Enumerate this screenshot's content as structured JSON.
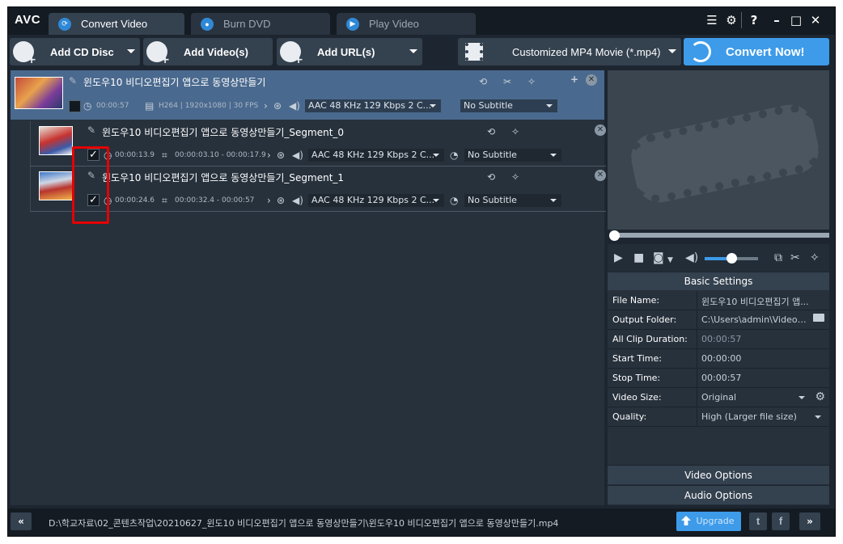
{
  "app": {
    "logo": "AVC"
  },
  "tabs": [
    {
      "label": "Convert Video",
      "icon": "refresh-icon"
    },
    {
      "label": "Burn DVD",
      "icon": "disc-icon"
    },
    {
      "label": "Play Video",
      "icon": "play-icon"
    }
  ],
  "window_controls": [
    "list-icon",
    "gear-icon",
    "help-icon",
    "minimize-icon",
    "maximize-icon",
    "close-icon"
  ],
  "help_label": "?",
  "toolbar": {
    "add_cd": "Add CD Disc",
    "add_video": "Add Video(s)",
    "add_url": "Add URL(s)",
    "profile": "Customized MP4 Movie (*.mp4)",
    "convert_now": "Convert Now!"
  },
  "files": {
    "main": {
      "title": "윈도우10 비디오편집기 앱으로 동영상만들기",
      "duration": "00:00:57",
      "video_info": "H264 | 1920x1080 | 30 FPS",
      "audio": "AAC 48 KHz 129 Kbps 2 C...",
      "subtitle": "No Subtitle"
    },
    "segments": [
      {
        "title": "윈도우10 비디오편집기 앱으로 동영상만들기_Segment_0",
        "duration": "00:00:13.9",
        "range": "00:00:03.10 - 00:00:17.9",
        "audio": "AAC 48 KHz 129 Kbps 2 C...",
        "subtitle": "No Subtitle",
        "checked": "✓"
      },
      {
        "title": "윈도우10 비디오편집기 앱으로 동영상만들기_Segment_1",
        "duration": "00:00:24.6",
        "range": "00:00:32.4 - 00:00:57",
        "audio": "AAC 48 KHz 129 Kbps 2 C...",
        "subtitle": "No Subtitle",
        "checked": "✓"
      }
    ]
  },
  "settings": {
    "header": "Basic Settings",
    "rows": [
      {
        "key": "File Name:",
        "value": "윈도우10 비디오편집기 앱..."
      },
      {
        "key": "Output Folder:",
        "value": "C:\\Users\\admin\\Videos..."
      },
      {
        "key": "All Clip Duration:",
        "value": "00:00:57"
      },
      {
        "key": "Start Time:",
        "value": "00:00:00"
      },
      {
        "key": "Stop Time:",
        "value": "00:00:57"
      },
      {
        "key": "Video Size:",
        "value": "Original"
      },
      {
        "key": "Quality:",
        "value": "High (Larger file size)"
      }
    ],
    "video_options": "Video Options",
    "audio_options": "Audio Options"
  },
  "player": {
    "volume_fraction": 0.5,
    "seek_fraction": 0.0
  },
  "statusbar": {
    "collapse": "«",
    "path": "D:\\학교자료\\02_콘텐츠작업\\20210627_윈도10 비디오편집기 앱으로 동영상만들기\\윈도우10 비디오편집기 앱으로 동영상만들기.mp4",
    "upgrade": "Upgrade",
    "twitter": "t",
    "facebook": "f",
    "expand": "»"
  },
  "colors": {
    "accent": "#3d9be9",
    "selected_row": "#4a698e",
    "highlight": "#e60000"
  }
}
